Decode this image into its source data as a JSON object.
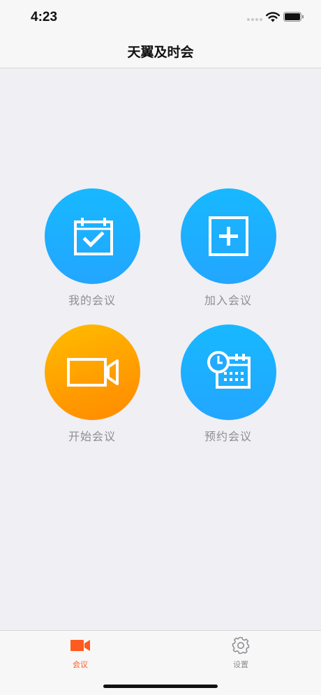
{
  "status_bar": {
    "time": "4:23"
  },
  "nav": {
    "title": "天翼及时会"
  },
  "features": [
    {
      "label": "我的会议",
      "icon": "calendar-check-icon",
      "color": "#1fb0ff"
    },
    {
      "label": "加入会议",
      "icon": "plus-square-icon",
      "color": "#1fb0ff"
    },
    {
      "label": "开始会议",
      "icon": "video-camera-icon",
      "color": "#ffa800"
    },
    {
      "label": "预约会议",
      "icon": "calendar-clock-icon",
      "color": "#1fb0ff"
    }
  ],
  "tabs": [
    {
      "label": "会议",
      "icon": "video-camera-icon",
      "active": true,
      "color": "#ff5a1f"
    },
    {
      "label": "设置",
      "icon": "gear-icon",
      "active": false,
      "color": "#8e8e93"
    }
  ],
  "colors": {
    "accent": "#ff5a1f",
    "primary_blue": "#1fb0ff",
    "orange": "#ffa800",
    "background": "#efeff4",
    "label_gray": "#8e8e93"
  }
}
